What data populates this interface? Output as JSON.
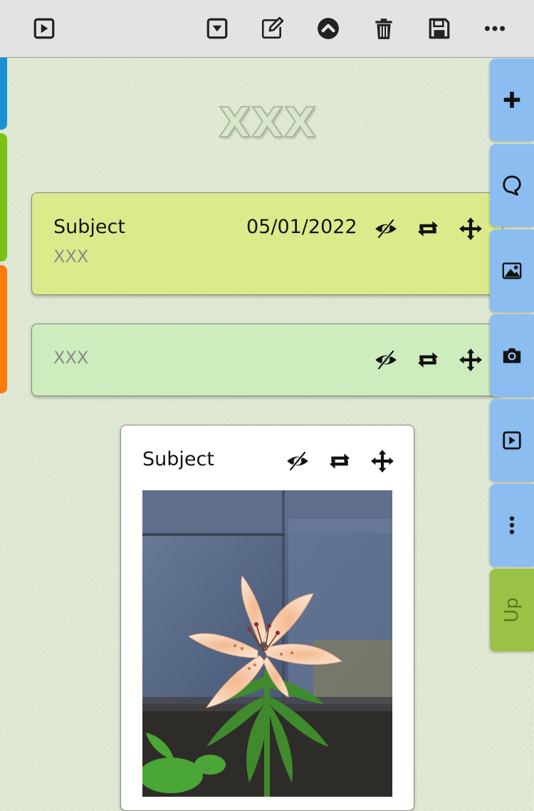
{
  "toolbar": {
    "buttons": [
      {
        "name": "play-icon"
      },
      {
        "name": "dropdown-icon"
      },
      {
        "name": "edit-icon"
      },
      {
        "name": "chevron-up-icon"
      },
      {
        "name": "trash-icon"
      },
      {
        "name": "save-icon"
      },
      {
        "name": "more-icon"
      }
    ]
  },
  "left_tabs": {
    "colors": [
      "#1a8fd6",
      "#7cc215",
      "#ff7a0d"
    ]
  },
  "board": {
    "title": "XXX"
  },
  "notes": [
    {
      "subject": "Subject",
      "text": "XXX",
      "date": "05/01/2022",
      "color": "#dcea8c",
      "icons": [
        "hide-icon",
        "repeat-icon",
        "move-icon"
      ]
    },
    {
      "subject": "",
      "text": "XXX",
      "color": "#cdedbf",
      "icons": [
        "hide-icon",
        "repeat-icon",
        "move-icon"
      ]
    },
    {
      "subject": "Subject",
      "color": "#ffffff",
      "image": "orange-lily-flower-photo",
      "icons": [
        "hide-icon",
        "repeat-icon",
        "move-icon"
      ]
    }
  ],
  "side_tabs": {
    "items": [
      {
        "icon": "plus-icon"
      },
      {
        "icon": "speech-bubble-icon"
      },
      {
        "icon": "image-icon"
      },
      {
        "icon": "camera-icon"
      },
      {
        "icon": "play-icon"
      },
      {
        "icon": "more-vertical-icon"
      }
    ],
    "up_label": "Up",
    "colors": {
      "blue": "#8bbdf1",
      "green": "#99c247"
    }
  }
}
